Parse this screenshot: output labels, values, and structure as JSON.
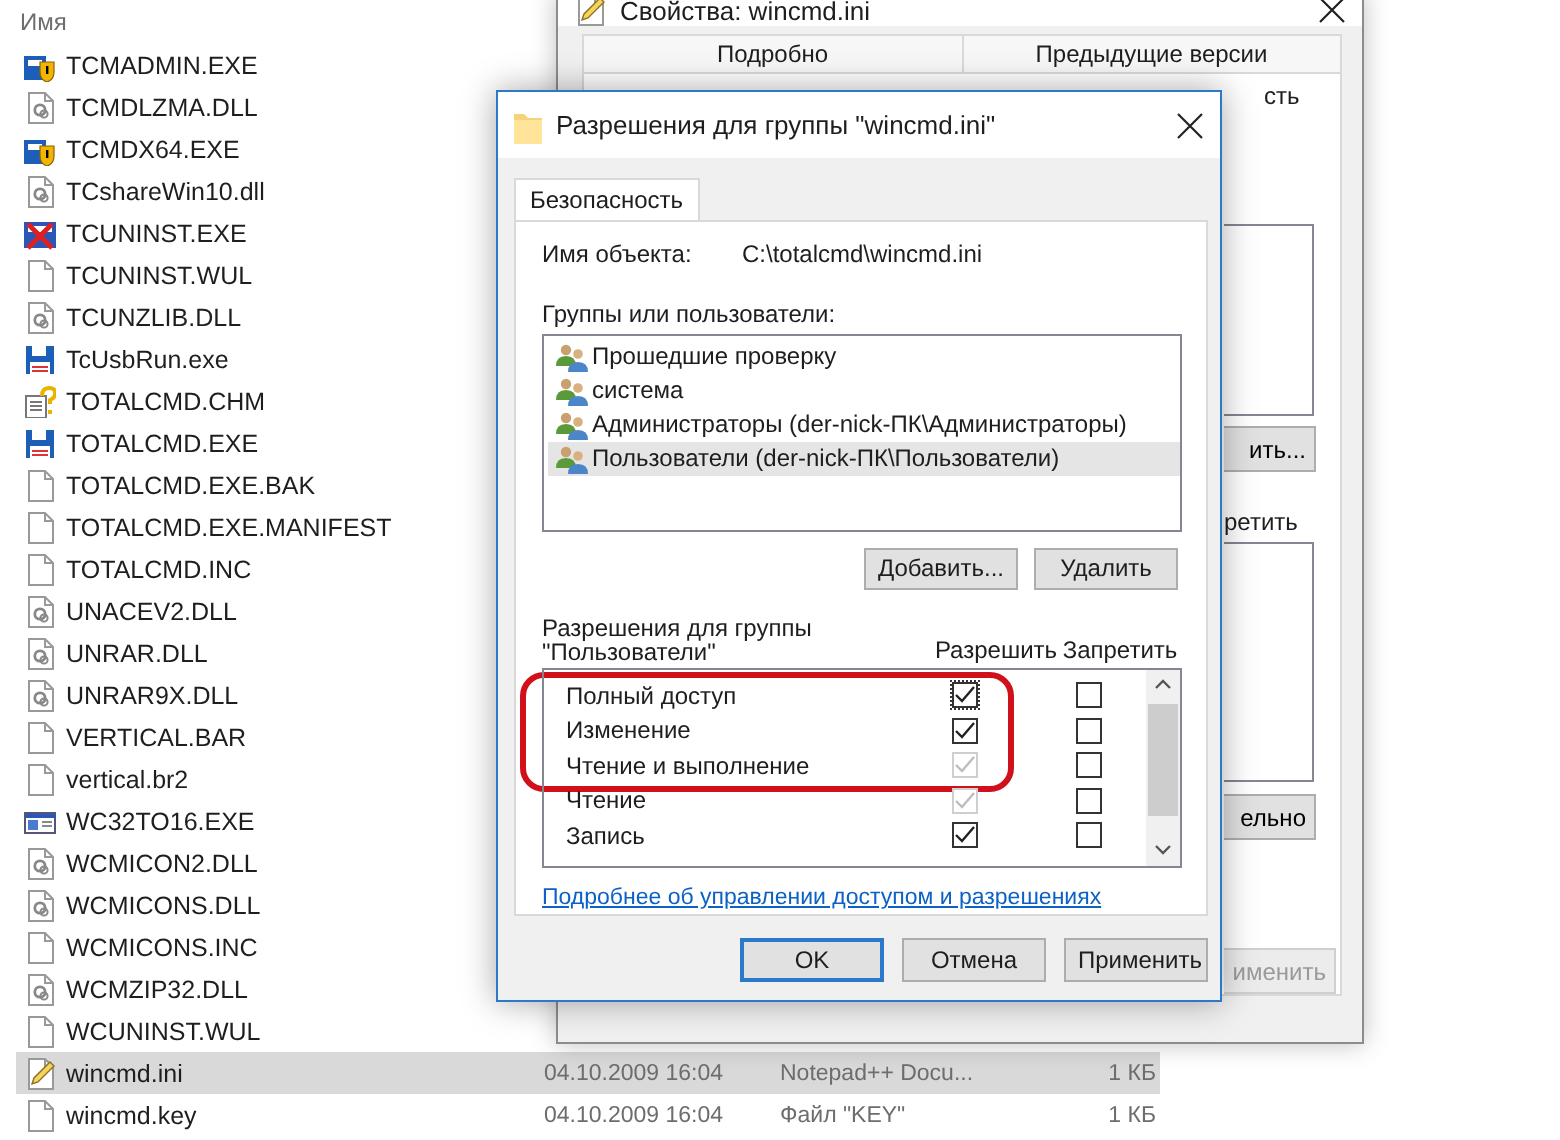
{
  "explorer": {
    "columns": [
      {
        "label": "Имя"
      }
    ],
    "files": [
      {
        "name": "TCMADMIN.EXE",
        "kind": "shield",
        "selected": false
      },
      {
        "name": "TCMDLZMA.DLL",
        "kind": "library",
        "selected": false
      },
      {
        "name": "TCMDX64.EXE",
        "kind": "shield",
        "selected": false
      },
      {
        "name": "TCshareWin10.dll",
        "kind": "library",
        "selected": false
      },
      {
        "name": "TCUNINST.EXE",
        "kind": "uninstaller",
        "selected": false
      },
      {
        "name": "TCUNINST.WUL",
        "kind": "plain",
        "selected": false
      },
      {
        "name": "TCUNZLIB.DLL",
        "kind": "library",
        "selected": false
      },
      {
        "name": "TcUsbRun.exe",
        "kind": "disk",
        "selected": false
      },
      {
        "name": "TOTALCMD.CHM",
        "kind": "help",
        "selected": false
      },
      {
        "name": "TOTALCMD.EXE",
        "kind": "disk",
        "selected": false
      },
      {
        "name": "TOTALCMD.EXE.BAK",
        "kind": "plain",
        "selected": false
      },
      {
        "name": "TOTALCMD.EXE.MANIFEST",
        "kind": "plain",
        "selected": false
      },
      {
        "name": "TOTALCMD.INC",
        "kind": "plain",
        "selected": false
      },
      {
        "name": "UNACEV2.DLL",
        "kind": "library",
        "selected": false
      },
      {
        "name": "UNRAR.DLL",
        "kind": "library",
        "selected": false
      },
      {
        "name": "UNRAR9X.DLL",
        "kind": "library",
        "selected": false
      },
      {
        "name": "VERTICAL.BAR",
        "kind": "plain",
        "selected": false
      },
      {
        "name": "vertical.br2",
        "kind": "plain",
        "selected": false
      },
      {
        "name": "WC32TO16.EXE",
        "kind": "program",
        "selected": false
      },
      {
        "name": "WCMICON2.DLL",
        "kind": "library",
        "selected": false
      },
      {
        "name": "WCMICONS.DLL",
        "kind": "library",
        "selected": false
      },
      {
        "name": "WCMICONS.INC",
        "kind": "plain",
        "selected": false
      },
      {
        "name": "WCMZIP32.DLL",
        "kind": "library",
        "selected": false
      },
      {
        "name": "WCUNINST.WUL",
        "kind": "plain",
        "selected": false
      },
      {
        "name": "wincmd.ini",
        "kind": "text",
        "selected": true,
        "date": "04.10.2009 16:04",
        "type": "Notepad++ Docu...",
        "size": "1 КБ"
      },
      {
        "name": "wincmd.key",
        "kind": "plain",
        "selected": false,
        "date": "04.10.2009 16:04",
        "type": "Файл \"KEY\"",
        "size": "1 КБ"
      }
    ]
  },
  "properties_window": {
    "title": "Свойства: wincmd.ini",
    "tabs": [
      {
        "label": "Подробно",
        "selected": false
      },
      {
        "label": "Предыдущие версии",
        "selected": false
      }
    ],
    "visible_parts": [
      {
        "kind": "text",
        "text": "сть"
      },
      {
        "kind": "list"
      },
      {
        "kind": "button",
        "text": "ить..."
      },
      {
        "kind": "text",
        "text": "ретить"
      },
      {
        "kind": "list"
      },
      {
        "kind": "button",
        "text": "ельно"
      },
      {
        "kind": "button",
        "text": "именить",
        "disabled": true
      }
    ]
  },
  "permissions_dialog": {
    "title": "Разрешения для группы \"wincmd.ini\"",
    "tabs": [
      {
        "label": "Безопасность",
        "selected": true
      }
    ],
    "object_label": "Имя объекта:",
    "object_value": "C:\\totalcmd\\wincmd.ini",
    "groups_label": "Группы или пользователи:",
    "groups": [
      {
        "name": "Прошедшие проверку",
        "selected": false
      },
      {
        "name": "система",
        "selected": false
      },
      {
        "name": "Администраторы (der-nick-ПК\\Администраторы)",
        "selected": false
      },
      {
        "name": "Пользователи (der-nick-ПК\\Пользователи)",
        "selected": true
      }
    ],
    "group_buttons": [
      "Добавить...",
      "Удалить"
    ],
    "permissions_label": [
      "Разрешения для группы",
      "\"Пользователи\""
    ],
    "permission_columns": [
      "Разрешить",
      "Запретить"
    ],
    "permissions": [
      {
        "name": "Полный доступ",
        "allow": {
          "checked": true,
          "disabled": false,
          "focused": true
        },
        "deny": {
          "checked": false,
          "disabled": false
        }
      },
      {
        "name": "Изменение",
        "allow": {
          "checked": true,
          "disabled": false,
          "focused": false
        },
        "deny": {
          "checked": false,
          "disabled": false
        }
      },
      {
        "name": "Чтение и выполнение",
        "allow": {
          "checked": true,
          "disabled": true,
          "focused": false
        },
        "deny": {
          "checked": false,
          "disabled": false
        }
      },
      {
        "name": "Чтение",
        "allow": {
          "checked": true,
          "disabled": true,
          "focused": false
        },
        "deny": {
          "checked": false,
          "disabled": false
        }
      },
      {
        "name": "Запись",
        "allow": {
          "checked": true,
          "disabled": false,
          "focused": false
        },
        "deny": {
          "checked": false,
          "disabled": false
        }
      }
    ],
    "highlight": true,
    "link": "Подробнее об управлении доступом и разрешениях",
    "buttons": [
      {
        "label": "OK",
        "default": true
      },
      {
        "label": "Отмена",
        "default": false
      },
      {
        "label": "Применить",
        "default": false
      }
    ]
  }
}
